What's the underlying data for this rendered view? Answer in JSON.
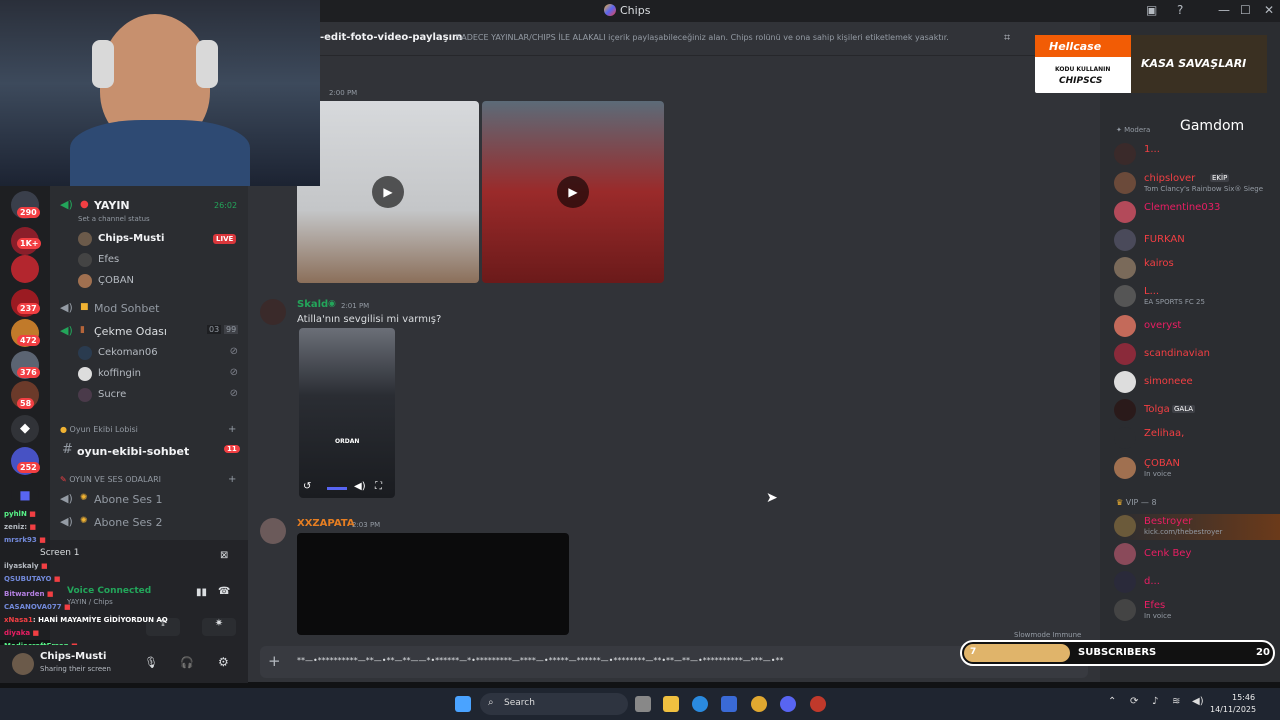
{
  "window": {
    "title": "Chips"
  },
  "channel_header": {
    "name": "-edit-foto-video-paylaşım",
    "topic": "SADECE YAYINLAR/CHIPS İLE ALAKALI içerik paylaşabileceğiniz alan. Chips rolünü ve ona sahip kişileri etiketlemek yasaktır."
  },
  "servers": {
    "badges": [
      "290",
      "1K+",
      "237",
      "472",
      "376",
      "58",
      "252"
    ]
  },
  "sidebar": {
    "yayin_channel": {
      "label": "YAYIN",
      "status": "Set a channel status",
      "timer": "26:02"
    },
    "yayin_users": [
      {
        "name": "Chips-Musti",
        "badge": "LIVE"
      },
      {
        "name": "Efes"
      },
      {
        "name": "ÇOBAN"
      }
    ],
    "mod_sohbet": "Mod Sohbet",
    "cekme_odasi": {
      "label": "Çekme Odası",
      "count_a": "03",
      "count_b": "99"
    },
    "cekme_users": [
      "Cekoman06",
      "koffingin",
      "Sucre"
    ],
    "category_oyun": "Oyun Ekibi Lobisi",
    "oyun_sohbet": {
      "label": "oyun-ekibi-sohbet",
      "badge": "11"
    },
    "category_voice": "OYUN VE SES ODALARI",
    "abone_1": "Abone Ses 1",
    "abone_2": "Abone Ses 2",
    "screen_label": "Screen 1",
    "voice_connected": "Voice Connected",
    "voice_sub": "YAYIN / Chips"
  },
  "user_panel": {
    "name": "Chips-Musti",
    "status": "Sharing their screen"
  },
  "messages": [
    {
      "time": "2:00 PM"
    },
    {
      "author": "Skald",
      "time": "2:01 PM",
      "text": "Atilla'nın sevgilisi mi varmış?",
      "image_caption": "ORDAN"
    },
    {
      "author": "XXZAPATA",
      "time": "2:03 PM"
    }
  ],
  "composer": {
    "slowmode": "Slowmode Immune",
    "text": "**—•**********—**—•**—**——*•******—*•*********—****—•*****—******—•********—**•**—**—•**********—***—•**"
  },
  "members": {
    "header": "Modera",
    "list": [
      {
        "name": "1...",
        "color": "#f23f43"
      },
      {
        "name": "chipslover",
        "tag": "EKİP",
        "sub": "Tom Clancy's Rainbow Six® Siege",
        "color": "#f23f43"
      },
      {
        "name": "Clementine033",
        "color": "#e91e63"
      },
      {
        "name": "FURKAN",
        "color": "#f23f43"
      },
      {
        "name": "kairos",
        "color": "#f23f43"
      },
      {
        "name": "L...",
        "sub": "EA SPORTS FC 25",
        "color": "#f23f43"
      },
      {
        "name": "overyst",
        "color": "#e91e63"
      },
      {
        "name": "scandinavian",
        "color": "#f23f43"
      },
      {
        "name": "simoneee",
        "color": "#f23f43"
      },
      {
        "name": "Tolga",
        "tag": "GALA",
        "color": "#f23f43"
      },
      {
        "name": "Zelihaa,",
        "color": "#f23f43"
      },
      {
        "name": "ÇOBAN",
        "sub": "In voice",
        "color": "#f23f43"
      }
    ],
    "vip_header": "VIP — 8",
    "vip_list": [
      {
        "name": "Bestroyer",
        "sub": "kick.com/thebestroyer",
        "color": "#e91e63"
      },
      {
        "name": "Cenk Bey",
        "color": "#e91e63"
      },
      {
        "name": "d...",
        "color": "#e91e63"
      },
      {
        "name": "Efes",
        "sub": "In voice",
        "color": "#e91e63"
      }
    ]
  },
  "ad": {
    "brand": "Hellcase",
    "code_line": "KODU KULLANIN",
    "code": "CHIPSCS",
    "slogan": "KASA SAVAŞLARI",
    "gamdom": "Gamdom"
  },
  "subscribers": {
    "label": "SUBSCRIBERS",
    "current": "7",
    "goal": "20"
  },
  "stream_chat": [
    {
      "user": "pyhlN",
      "color": "#57f287"
    },
    {
      "user": "zeniz:",
      "color": "#b5bac1"
    },
    {
      "user": "mrsrk93",
      "color": "#5865f2"
    },
    {
      "user": "QSUBUTAYO",
      "color": "#5865f2"
    },
    {
      "user": "ilyaskaly",
      "color": "#b5bac1"
    },
    {
      "user": "Bitwarden",
      "color": "#9b59b6"
    },
    {
      "user": "CASANOVA077",
      "color": "#5865f2"
    },
    {
      "user": "xNasa1",
      "color": "#f23f43",
      "text": "HANİ MAYAMİYE GİDİYORDUN AQ"
    },
    {
      "user": "diyaka",
      "color": "#e91e63"
    },
    {
      "user": "MediacraftErsan",
      "color": "#57f287"
    }
  ],
  "taskbar": {
    "search": "Search",
    "time": "15:46",
    "date": "14/11/2025"
  },
  "colors": {
    "accent": "#5865f2",
    "live": "#da373c",
    "bg": "#313338"
  }
}
